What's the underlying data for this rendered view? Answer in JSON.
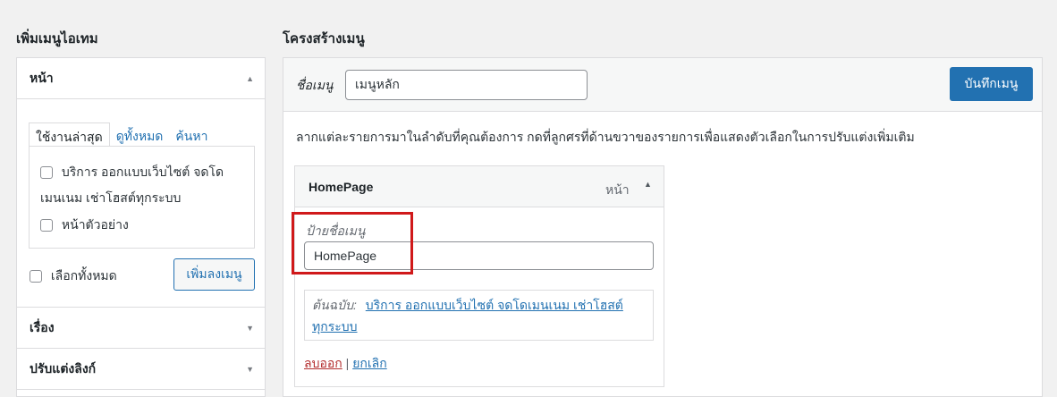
{
  "left": {
    "title": "เพิ่มเมนูไอเทม",
    "pages_section": {
      "title": "หน้า",
      "tabs": [
        "ใช้งานล่าสุด",
        "ดูทั้งหมด",
        "ค้นหา"
      ],
      "items": [
        {
          "label_line1": "บริการ ออกแบบเว็บไซต์ จดโด",
          "label_line2": "เมนเนม เช่าโฮสต์ทุกระบบ"
        },
        {
          "label_line1": "หน้าตัวอย่าง"
        }
      ],
      "select_all": "เลือกทั้งหมด",
      "add_button": "เพิ่มลงเมนู"
    },
    "posts_section": "เรื่อง",
    "custom_links_section": "ปรับแต่งลิงก์"
  },
  "right": {
    "title": "โครงสร้างเมนู",
    "menu_name_label": "ชื่อเมนู",
    "menu_name_value": "เมนูหลัก",
    "save_button": "บันทึกเมนู",
    "instructions": "ลากแต่ละรายการมาในลำดับที่คุณต้องการ กดที่ลูกศรที่ด้านขวาของรายการเพื่อแสดงตัวเลือกในการปรับแต่งเพิ่มเติม",
    "menu_item": {
      "title": "HomePage",
      "type": "หน้า",
      "nav_label_caption": "ป้ายชื่อเมนู",
      "nav_label_value": "HomePage",
      "original_caption": "ต้นฉบับ:",
      "original_link_line1": "บริการ ออกแบบเว็บไซต์ จดโดเมนเนม เช่าโฮสต์",
      "original_link_line2": "ทุกระบบ",
      "remove": "ลบออก",
      "separator": "|",
      "cancel": "ยกเลิก"
    }
  },
  "colors": {
    "accent": "#2271b1",
    "highlight": "#d0191a",
    "danger": "#b32d2e"
  }
}
